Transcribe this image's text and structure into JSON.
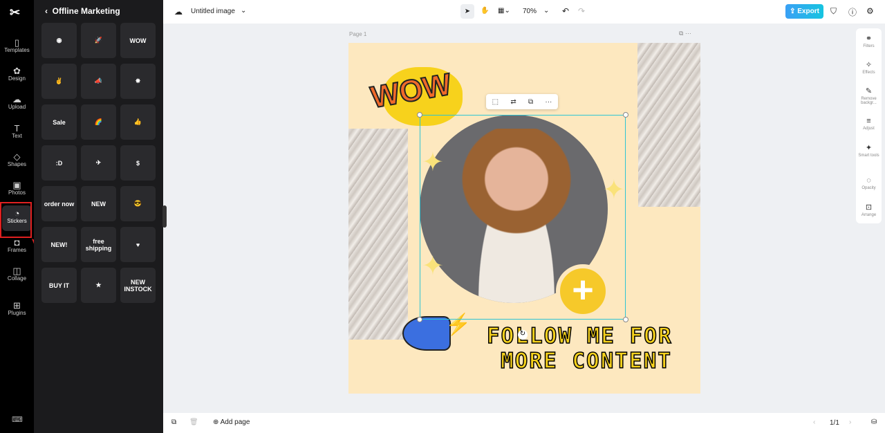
{
  "rail": {
    "items": [
      {
        "label": "Templates",
        "icon": "▯"
      },
      {
        "label": "Design",
        "icon": "✿"
      },
      {
        "label": "Upload",
        "icon": "☁"
      },
      {
        "label": "Text",
        "icon": "T"
      },
      {
        "label": "Shapes",
        "icon": "◇"
      },
      {
        "label": "Photos",
        "icon": "▣"
      },
      {
        "label": "Stickers",
        "icon": "◔"
      },
      {
        "label": "Frames",
        "icon": "◘"
      },
      {
        "label": "Collage",
        "icon": "◫"
      },
      {
        "label": "Plugins",
        "icon": "⊞"
      }
    ]
  },
  "panel": {
    "title": "Offline Marketing",
    "stickers": [
      "◉",
      "🚀",
      "WOW",
      "✌",
      "📣",
      "✸",
      "Sale",
      "🌈",
      "👍",
      ":D",
      "✈",
      "$",
      "order now",
      "NEW",
      "😎",
      "NEW!",
      "free shipping",
      "♥",
      "BUY IT",
      "★",
      "NEW INSTOCK"
    ]
  },
  "topbar": {
    "title": "Untitled image",
    "zoom": "70%",
    "export": "Export"
  },
  "canvas": {
    "page_label": "Page 1",
    "headline1": "FOLLOW ME FOR",
    "headline2": "MORE CONTENT",
    "wow": "WOW"
  },
  "right_panel": [
    {
      "label": "Filters",
      "icon": "⚭"
    },
    {
      "label": "Effects",
      "icon": "✧"
    },
    {
      "label": "Remove backgr...",
      "icon": "✎"
    },
    {
      "label": "Adjust",
      "icon": "≡"
    },
    {
      "label": "Smart tools",
      "icon": "✦"
    },
    {
      "label": "Opacity",
      "icon": "◌"
    },
    {
      "label": "Arrange",
      "icon": "⊡"
    }
  ],
  "bottom": {
    "add_page": "Add page",
    "pages": "1/1"
  }
}
